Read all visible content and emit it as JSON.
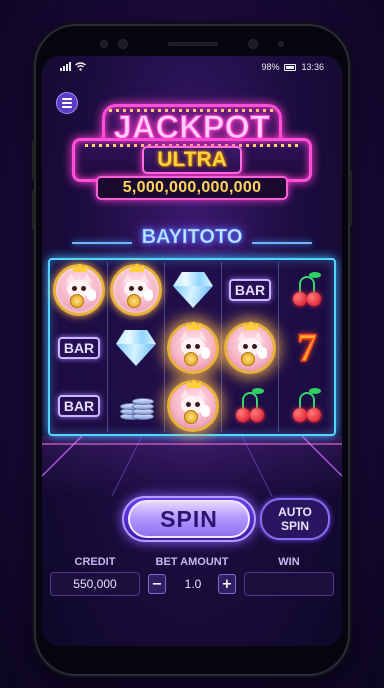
{
  "status_bar": {
    "battery": "98%",
    "time": "13:36"
  },
  "jackpot": {
    "title": "JACKPOT",
    "subtitle": "ULTRA",
    "amount": "5,000,000,000,000"
  },
  "brand": "BAYITOTO",
  "reels": {
    "symbols": [
      [
        "lucky-cat",
        "bar",
        "bar"
      ],
      [
        "lucky-cat",
        "diamond",
        "coins"
      ],
      [
        "diamond",
        "lucky-cat",
        "lucky-cat"
      ],
      [
        "bar",
        "lucky-cat",
        "cherries"
      ],
      [
        "cherries",
        "seven",
        "cherries"
      ]
    ],
    "bar_label": "BAR"
  },
  "controls": {
    "spin_label": "SPIN",
    "auto_spin_line1": "AUTO",
    "auto_spin_line2": "SPIN",
    "credit_label": "CREDIT",
    "credit_value": "550,000",
    "bet_label": "BET AMOUNT",
    "bet_value": "1.0",
    "bet_minus": "−",
    "bet_plus": "+",
    "win_label": "WIN",
    "win_value": ""
  },
  "colors": {
    "neon_pink": "#ff4fd8",
    "neon_blue": "#4fd8ff",
    "gold": "#ffd23f",
    "purple_button": "#8f70ee"
  }
}
